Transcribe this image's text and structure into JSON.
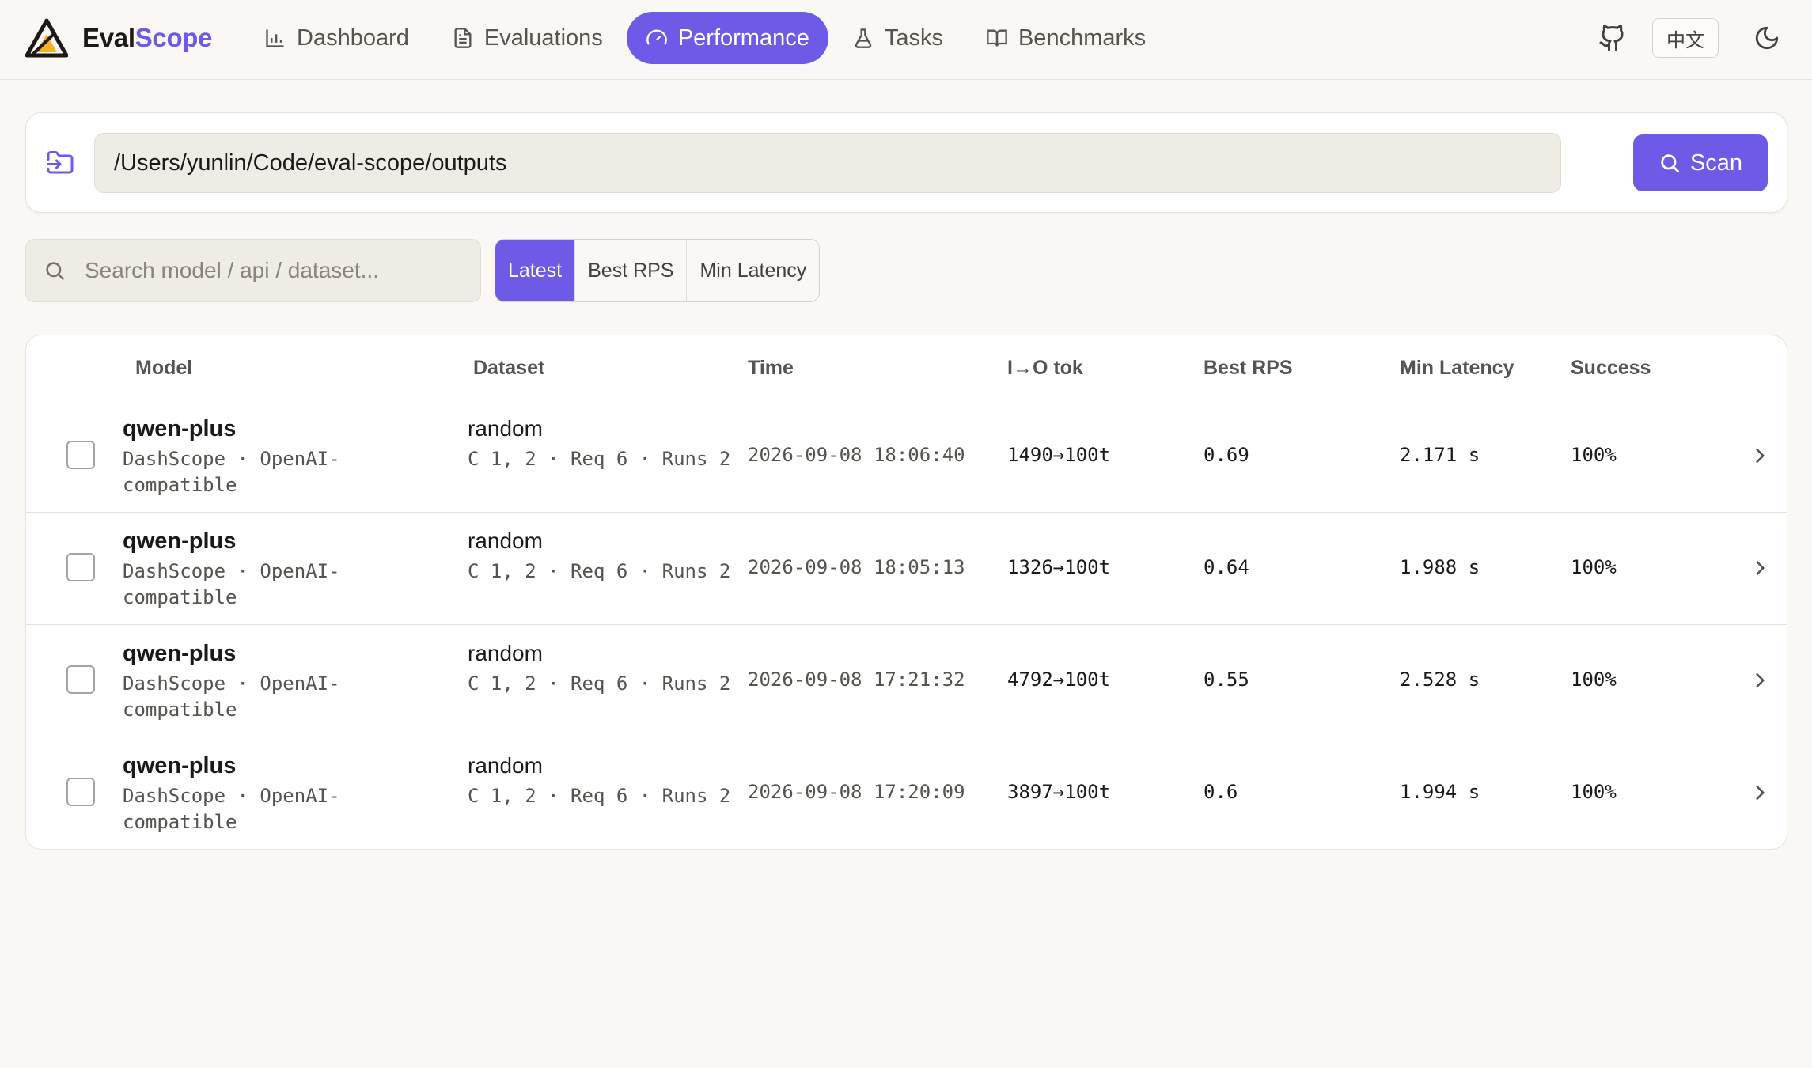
{
  "brand": {
    "part1": "Eval",
    "part2": "Scope"
  },
  "nav": [
    {
      "label": "Dashboard",
      "icon": "bar-chart-icon"
    },
    {
      "label": "Evaluations",
      "icon": "document-icon"
    },
    {
      "label": "Performance",
      "icon": "gauge-icon",
      "active": true
    },
    {
      "label": "Tasks",
      "icon": "flask-icon"
    },
    {
      "label": "Benchmarks",
      "icon": "book-icon"
    }
  ],
  "topright": {
    "lang": "中文"
  },
  "scan": {
    "path": "/Users/yunlin/Code/eval-scope/outputs",
    "button": "Scan"
  },
  "search": {
    "placeholder": "Search model / api / dataset..."
  },
  "sort": {
    "latest": "Latest",
    "best_rps": "Best RPS",
    "min_latency": "Min Latency"
  },
  "table": {
    "headers": {
      "model": "Model",
      "dataset": "Dataset",
      "time": "Time",
      "io": "I→O tok",
      "rps": "Best RPS",
      "latency": "Min Latency",
      "success": "Success"
    },
    "rows": [
      {
        "model": "qwen-plus",
        "api": "DashScope · OpenAI-compatible",
        "dataset": "random",
        "meta": "C 1, 2 · Req 6 · Runs 2",
        "time": "2026-09-08 18:06:40",
        "io": "1490→100t",
        "rps": "0.69",
        "latency": "2.171 s",
        "success": "100%"
      },
      {
        "model": "qwen-plus",
        "api": "DashScope · OpenAI-compatible",
        "dataset": "random",
        "meta": "C 1, 2 · Req 6 · Runs 2",
        "time": "2026-09-08 18:05:13",
        "io": "1326→100t",
        "rps": "0.64",
        "latency": "1.988 s",
        "success": "100%"
      },
      {
        "model": "qwen-plus",
        "api": "DashScope · OpenAI-compatible",
        "dataset": "random",
        "meta": "C 1, 2 · Req 6 · Runs 2",
        "time": "2026-09-08 17:21:32",
        "io": "4792→100t",
        "rps": "0.55",
        "latency": "2.528 s",
        "success": "100%"
      },
      {
        "model": "qwen-plus",
        "api": "DashScope · OpenAI-compatible",
        "dataset": "random",
        "meta": "C 1, 2 · Req 6 · Runs 2",
        "time": "2026-09-08 17:20:09",
        "io": "3897→100t",
        "rps": "0.6",
        "latency": "1.994 s",
        "success": "100%"
      }
    ]
  },
  "colors": {
    "accent": "#6d5ae6",
    "background": "#faf8f5"
  }
}
